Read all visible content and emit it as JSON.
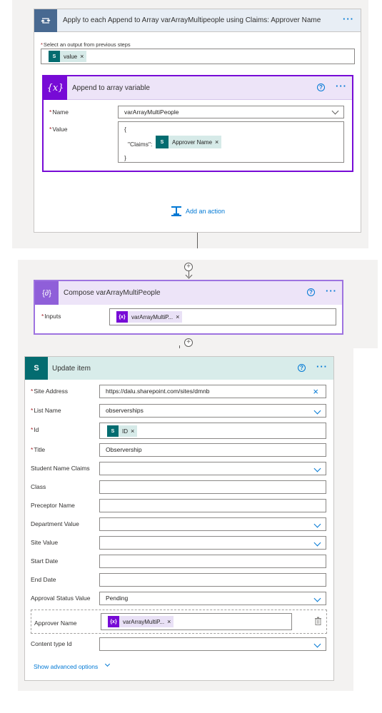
{
  "apply_each": {
    "title": "Apply to each Append to Array varArrayMultipeople using Claims: Approver Name",
    "select_label": "Select an output from previous steps",
    "token": "value"
  },
  "append": {
    "title": "Append to array variable",
    "name_label": "Name",
    "name_value": "varArrayMultiPeople",
    "value_label": "Value",
    "json_open": "{",
    "claims_key": "\"Claims\":",
    "claims_token": "Approver Name",
    "json_close": "}"
  },
  "add_action": "Add an action",
  "compose": {
    "title": "Compose varArrayMultiPeople",
    "inputs_label": "Inputs",
    "inputs_token": "varArrayMultiP..."
  },
  "update": {
    "title": "Update item",
    "fields": [
      {
        "label": "Site Address",
        "required": "*",
        "value": "https://dalu.sharepoint.com/sites/dmnb"
      },
      {
        "label": "List Name",
        "required": "*",
        "value": "observerships"
      },
      {
        "label": "Id",
        "required": "*",
        "token": "ID"
      },
      {
        "label": "Title",
        "required": "*",
        "value": "Observership"
      },
      {
        "label": "Student Name Claims",
        "value": ""
      },
      {
        "label": "Class",
        "value": ""
      },
      {
        "label": "Preceptor Name",
        "value": ""
      },
      {
        "label": "Department Value",
        "value": ""
      },
      {
        "label": "Site Value",
        "value": ""
      },
      {
        "label": "Start Date",
        "value": ""
      },
      {
        "label": "End Date",
        "value": ""
      },
      {
        "label": "Approval Status Value",
        "value": "Pending"
      },
      {
        "label": "Approver Name",
        "token": "varArrayMultiP..."
      },
      {
        "label": "Content type Id",
        "value": ""
      }
    ],
    "show_advanced": "Show advanced options"
  },
  "colors": {
    "loop_header": "#3c6e98",
    "variable_purple": "#770bd6",
    "sharepoint_teal": "#036c70",
    "link_blue": "#0078d4"
  }
}
